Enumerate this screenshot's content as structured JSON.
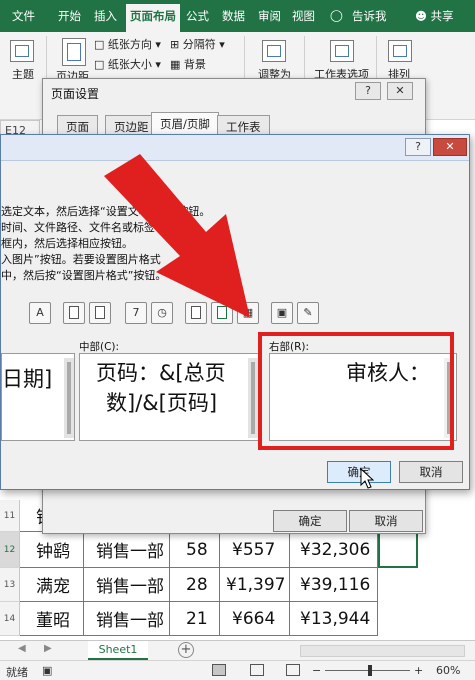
{
  "ribbon_tabs": [
    "文件",
    "开始",
    "插入",
    "页面布局",
    "公式",
    "数据",
    "审阅",
    "视图"
  ],
  "tell_me": "告诉我",
  "share": "共享",
  "ribbon": {
    "theme": "主题",
    "margins": "页边距",
    "orientation": "纸张方向",
    "size": "纸张大小",
    "breaks": "分隔符",
    "background": "背景",
    "scale_to_fit": "调整为",
    "sheet_options": "工作表选项",
    "arrange": "排列"
  },
  "namebox": "E12",
  "rows": [
    {
      "row": "11",
      "name": "钟",
      "dept": "",
      "qty": "",
      "price": "",
      "total": ""
    },
    {
      "row": "12",
      "name": "钟鹞",
      "dept": "销售一部",
      "qty": "58",
      "price": "¥557",
      "total": "¥32,306"
    },
    {
      "row": "13",
      "name": "满宠",
      "dept": "销售一部",
      "qty": "28",
      "price": "¥1,397",
      "total": "¥39,116"
    },
    {
      "row": "14",
      "name": "董昭",
      "dept": "销售一部",
      "qty": "21",
      "price": "¥664",
      "total": "¥13,944"
    }
  ],
  "sheet_tab": "Sheet1",
  "status": {
    "ready": "就绪",
    "zoom": "60%"
  },
  "page_setup": {
    "title": "页面设置",
    "tabs": [
      "页面",
      "页边距",
      "页眉/页脚",
      "工作表"
    ],
    "ok": "确定",
    "cancel": "取消"
  },
  "footer_dialog": {
    "instructions": [
      "选定文本，然后选择“设置文本格式”按钮。",
      "时间、文件路径、文件名或标签名：",
      "框内，然后选择相应按钮。",
      "入图片”按钮。若要设置图片格式",
      "中，然后按“设置图片格式”按钮。"
    ],
    "format_text_btn": "A",
    "left_partial": "日期]",
    "center_label": "中部(C):",
    "center_text_line1": "页码：&[总页",
    "center_text_line2": "数]/&[页码]",
    "right_label": "右部(R):",
    "right_text": "审核人：",
    "ok": "确定",
    "cancel": "取消"
  },
  "colors": {
    "excel_green": "#217346",
    "highlight_red": "#e01f1f"
  }
}
